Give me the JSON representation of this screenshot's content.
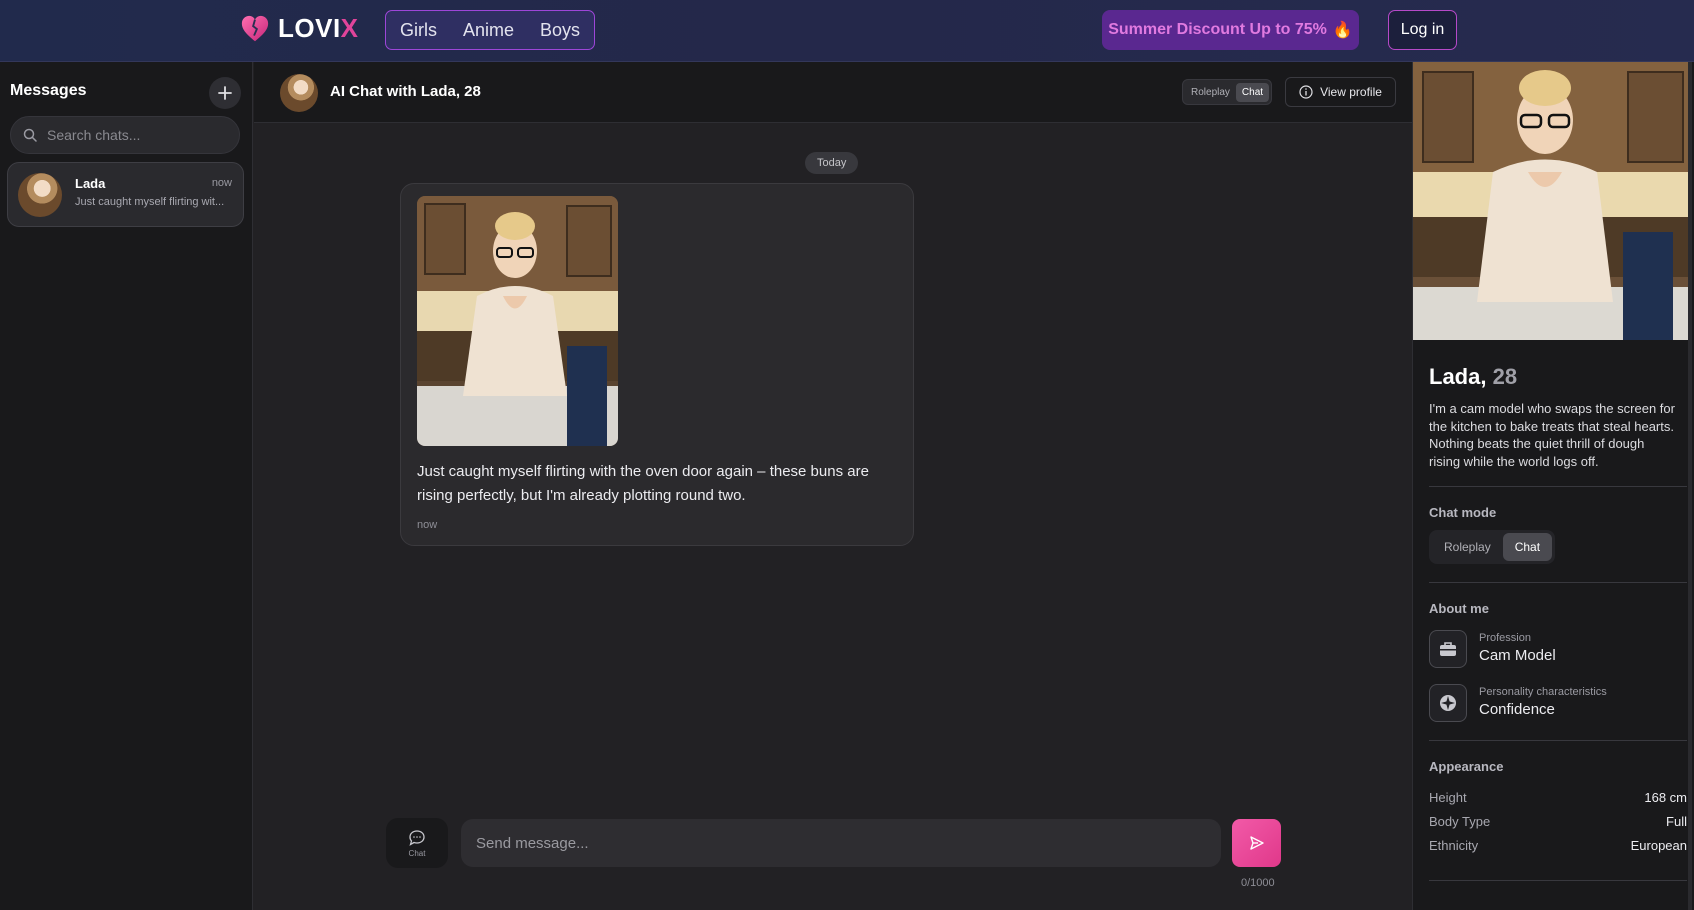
{
  "header": {
    "logo_text_main": "LOVI",
    "logo_text_accent": "X",
    "nav": [
      "Girls",
      "Anime",
      "Boys"
    ],
    "promo": "Summer Discount Up to 75%",
    "promo_emoji": "🔥",
    "login": "Log in"
  },
  "sidebar": {
    "title": "Messages",
    "add_icon": "plus-icon",
    "search_placeholder": "Search chats...",
    "chats": [
      {
        "name": "Lada",
        "time": "now",
        "preview": "Just caught myself flirting wit..."
      }
    ]
  },
  "chat": {
    "title": "AI Chat with Lada, 28",
    "modes": [
      "Roleplay",
      "Chat"
    ],
    "active_mode": "Chat",
    "view_profile": "View profile",
    "date_label": "Today",
    "messages": [
      {
        "text": "Just caught myself flirting with the oven door again – these buns are rising perfectly, but I'm already plotting round two.",
        "time": "now",
        "has_image": true
      }
    ]
  },
  "composer": {
    "mode_label": "Chat",
    "placeholder": "Send message...",
    "counter": "0/1000"
  },
  "profile": {
    "name": "Lada,",
    "age": "28",
    "bio": "I'm a cam model who swaps the screen for the kitchen to bake treats that steal hearts. Nothing beats the quiet thrill of dough rising while the world logs off.",
    "chat_mode_title": "Chat mode",
    "modes": [
      "Roleplay",
      "Chat"
    ],
    "active_mode": "Chat",
    "about_title": "About me",
    "about": [
      {
        "label": "Profession",
        "value": "Cam Model",
        "icon": "briefcase-icon"
      },
      {
        "label": "Personality characteristics",
        "value": "Confidence",
        "icon": "compass-icon"
      }
    ],
    "appearance_title": "Appearance",
    "appearance": [
      {
        "key": "Height",
        "value": "168 cm"
      },
      {
        "key": "Body Type",
        "value": "Full"
      },
      {
        "key": "Ethnicity",
        "value": "European"
      }
    ]
  },
  "colors": {
    "accent_pink": "#e0449a",
    "nav_border": "#9d46d8",
    "promo_bg": "#5a2890",
    "send_button": "#e84a9a"
  }
}
